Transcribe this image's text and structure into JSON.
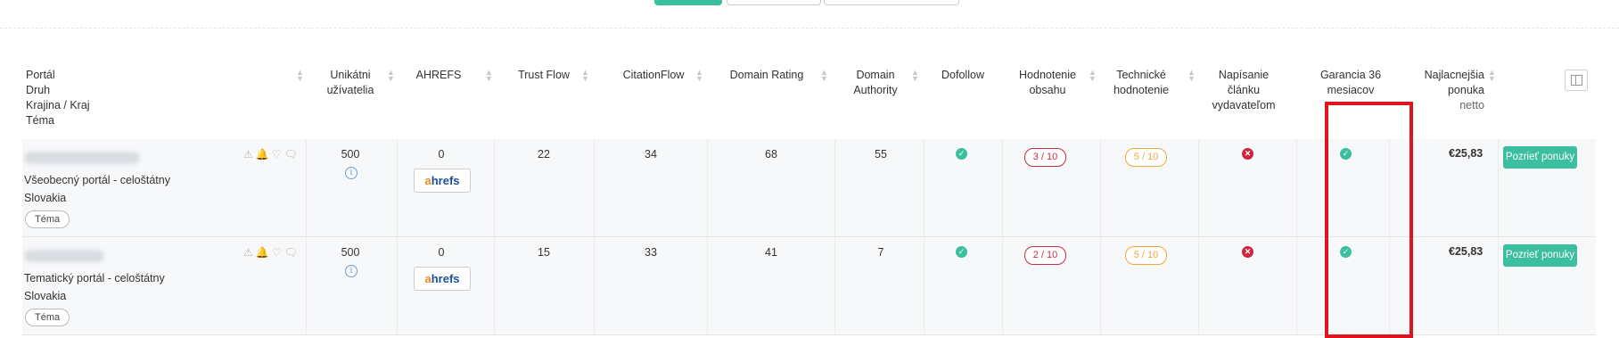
{
  "headers": {
    "portal": "Portál",
    "portal_sub1": "Druh",
    "portal_sub2": "Krajina / Kraj",
    "portal_sub3": "Téma",
    "unique_users": "Unikátni užívatelia",
    "ahrefs": "AHREFS",
    "trust_flow": "Trust Flow",
    "citation_flow": "CitationFlow",
    "domain_rating": "Domain Rating",
    "domain_authority": "Domain Authority",
    "dofollow": "Dofollow",
    "content_rating": "Hodnotenie obsahu",
    "technical_rating": "Technické hodnotenie",
    "writing": "Napísanie článku vydavateľom",
    "guarantee": "Garancia 36 mesiacov",
    "cheapest": "Najlacnejšia ponuka",
    "cheapest_sub": "netto"
  },
  "rows": [
    {
      "type": "Všeobecný portál - celoštátny",
      "country": "Slovakia",
      "topic_tag": "Téma",
      "unique_users": "500",
      "ahrefs": "0",
      "ahrefs_logo_a": "a",
      "ahrefs_logo_rest": "hrefs",
      "trust_flow": "22",
      "citation_flow": "34",
      "domain_rating": "68",
      "domain_authority": "55",
      "content_rating": "3 / 10",
      "technical_rating": "5 / 10",
      "price": "€25,83",
      "offer_button": "Pozrieť ponuky"
    },
    {
      "type": "Tematický portál - celoštátny",
      "country": "Slovakia",
      "topic_tag": "Téma",
      "unique_users": "500",
      "ahrefs": "0",
      "ahrefs_logo_a": "a",
      "ahrefs_logo_rest": "hrefs",
      "trust_flow": "15",
      "citation_flow": "33",
      "domain_rating": "41",
      "domain_authority": "7",
      "content_rating": "2 / 10",
      "technical_rating": "5 / 10",
      "price": "€25,83",
      "offer_button": "Pozrieť ponuky"
    }
  ],
  "icons": {
    "row_actions": "⚠🔔♡🗨",
    "info": "i",
    "check": "✓",
    "cross": "✕"
  },
  "colors": {
    "accent": "#3bbf9e",
    "highlight": "#e0141e",
    "bad_rating": "#c62e45",
    "mid_rating": "#f0a640"
  }
}
